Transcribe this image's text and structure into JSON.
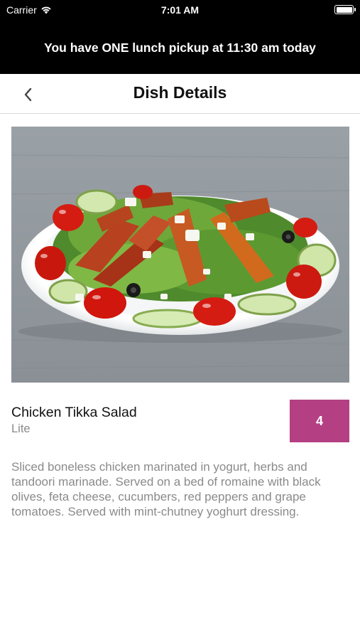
{
  "status_bar": {
    "carrier": "Carrier",
    "time": "7:01 AM",
    "icons": [
      "wifi-icon",
      "battery-icon"
    ]
  },
  "banner": {
    "text": "You have ONE lunch pickup at 11:30 am today"
  },
  "nav": {
    "title": "Dish Details",
    "back_icon": "chevron-left-icon"
  },
  "dish": {
    "name": "Chicken Tikka Salad",
    "category": "Lite",
    "quantity": "4",
    "description": "Sliced boneless chicken marinated in yogurt, herbs and tandoori marinade. Served on a bed of romaine with black olives, feta cheese, cucumbers, red peppers and grape tomatoes.  Served with mint-chutney yoghurt dressing."
  },
  "colors": {
    "banner_bg": "#000000",
    "badge_bg": "#b44083",
    "secondary_text": "#8a8a8a"
  }
}
